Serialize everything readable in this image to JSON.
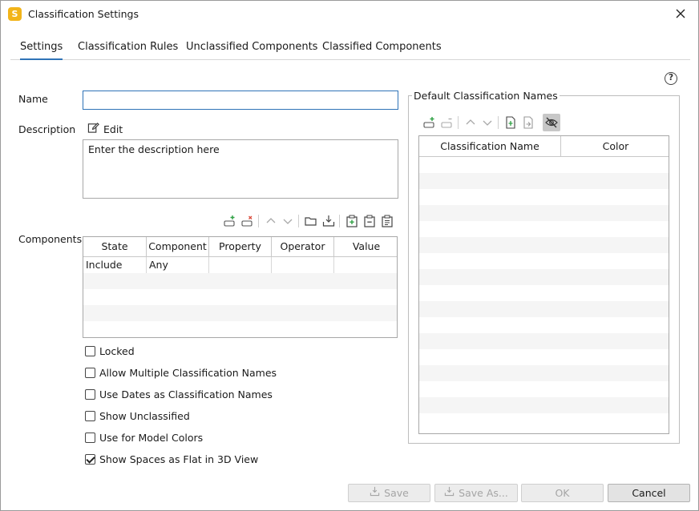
{
  "window": {
    "title": "Classification Settings",
    "app_icon_letter": "S"
  },
  "tabs": [
    {
      "label": "Settings",
      "active": true
    },
    {
      "label": "Classification Rules",
      "active": false
    },
    {
      "label": "Unclassified Components",
      "active": false
    },
    {
      "label": "Classified Components",
      "active": false
    }
  ],
  "form": {
    "name_label": "Name",
    "name_value": "",
    "description_label": "Description",
    "edit_label": "Edit",
    "description_value": "Enter the description here",
    "components_label": "Components"
  },
  "components_table": {
    "columns": [
      "State",
      "Component",
      "Property",
      "Operator",
      "Value"
    ],
    "rows": [
      [
        "Include",
        "Any",
        "",
        "",
        ""
      ]
    ]
  },
  "checkboxes": [
    {
      "label": "Locked",
      "checked": false
    },
    {
      "label": "Allow Multiple Classification Names",
      "checked": false
    },
    {
      "label": "Use Dates as Classification Names",
      "checked": false
    },
    {
      "label": "Show Unclassified",
      "checked": false
    },
    {
      "label": "Use for Model Colors",
      "checked": false
    },
    {
      "label": "Show Spaces as Flat in 3D View",
      "checked": true
    }
  ],
  "default_names": {
    "group_title": "Default Classification Names",
    "columns": [
      "Classification Name",
      "Color"
    ]
  },
  "buttons": {
    "save": "Save",
    "save_as": "Save As...",
    "ok": "OK",
    "cancel": "Cancel"
  },
  "help_glyph": "?",
  "colors": {
    "accent": "#2f73b7",
    "app_icon": "#f2b41a",
    "add_green": "#2ea043",
    "remove_red": "#d94a3a"
  }
}
